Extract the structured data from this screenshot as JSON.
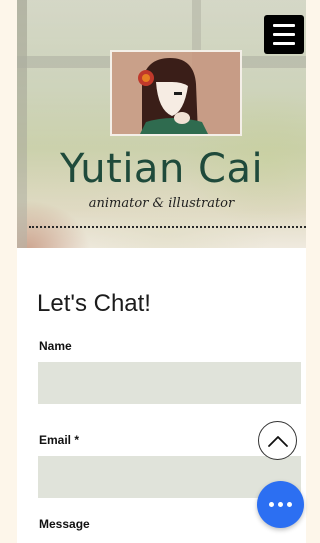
{
  "site": {
    "name": "Yutian Cai",
    "tagline": "animator & illustrator"
  },
  "contact_form": {
    "title": "Let's Chat!",
    "fields": [
      {
        "label": "Name",
        "value": ""
      },
      {
        "label": "Email *",
        "value": ""
      },
      {
        "label": "Message",
        "value": ""
      }
    ]
  },
  "icons": {
    "menu": "hamburger-menu-icon",
    "scroll_top": "chevron-up-icon",
    "chat": "ellipsis-icon"
  },
  "colors": {
    "brand_text": "#1f4a3b",
    "field_bg": "#e0e3da",
    "chat_button": "#2c6ff2"
  }
}
